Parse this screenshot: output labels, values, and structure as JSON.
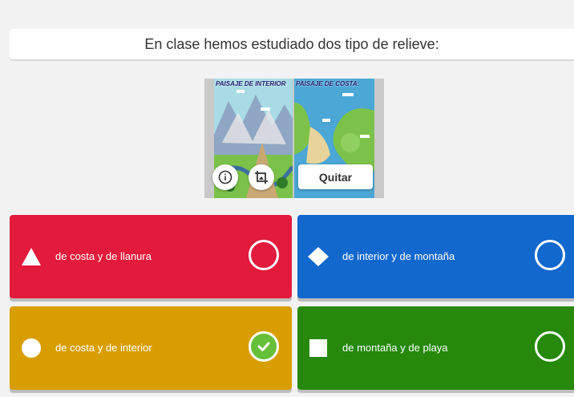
{
  "question": {
    "text": "En clase hemos estudiado dos tipo de relieve:"
  },
  "media": {
    "left_title": "PAISAJE DE INTERIOR",
    "right_title": "PAISAJE DE COSTA:",
    "remove_label": "Quitar",
    "info_icon": "info-icon",
    "crop_icon": "crop-image-icon"
  },
  "answers": [
    {
      "label": "de costa y de llanura",
      "shape": "triangle",
      "color": "#e21b3c",
      "correct": false
    },
    {
      "label": "de interior y de montaña",
      "shape": "diamond",
      "color": "#1368ce",
      "correct": false
    },
    {
      "label": "de costa y de interior",
      "shape": "circle",
      "color": "#d89e00",
      "correct": true
    },
    {
      "label": "de montaña y de playa",
      "shape": "square",
      "color": "#26890c",
      "correct": false
    }
  ],
  "colors": {
    "correct_check": "#66bf39",
    "background": "#f2f2f2"
  }
}
